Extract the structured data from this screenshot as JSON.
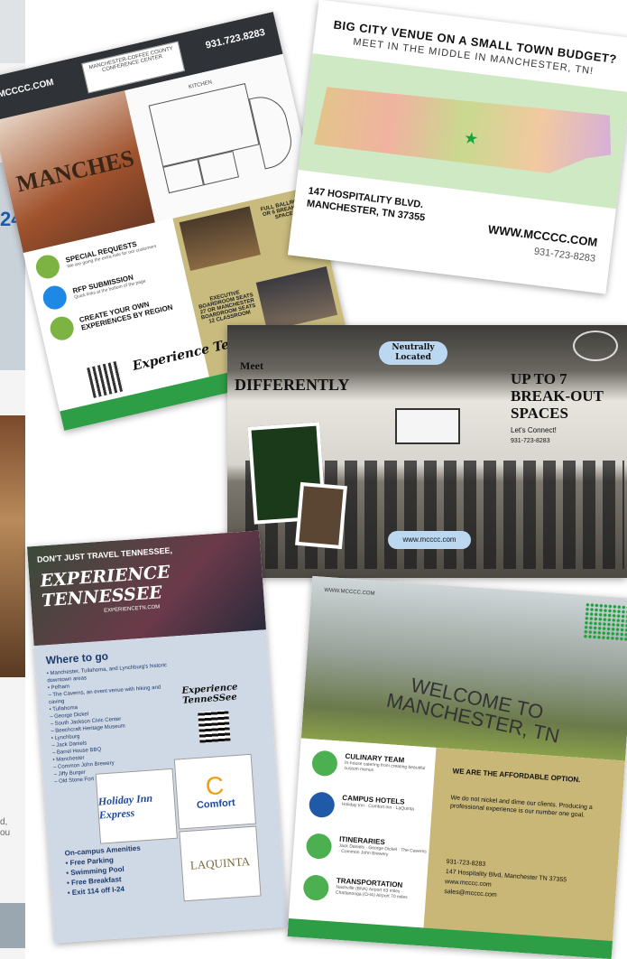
{
  "strip": {
    "number": "24",
    "caption": "d,\nou"
  },
  "card1": {
    "site": "MCCCC.COM",
    "phone": "931.723.8283",
    "logo": "MANCHESTER-COFFEE COUNTY CONFERENCE CENTER",
    "building_text": "MANCHES",
    "plan_label": "KITCHEN",
    "special_title": "SPECIAL REQUESTS",
    "special_desc": "We are going the extra mile for our customers",
    "rfp_title": "RFP SUBMISSION",
    "rfp_desc": "Quick links at the bottom of the page",
    "create_title": "CREATE YOUR OWN EXPERIENCES BY REGION",
    "ballroom": "FULL BALLROOM OR 6 BREAKOUT SPACES",
    "executive": "EXECUTIVE BOARDROOM SEATS 27 OR MANCHESTER BOARDROOM SEATS 12 CLASSROOM",
    "experience": "Experience TenneSSee"
  },
  "card2": {
    "headline": "BIG CITY VENUE ON A SMALL TOWN BUDGET?",
    "subhead": "MEET IN THE MIDDLE IN MANCHESTER, TN!",
    "address_line1": "147 HOSPITALITY BLVD.",
    "address_line2": "MANCHESTER, TN 37355",
    "website": "WWW.MCCCC.COM",
    "phone": "931-723-8283"
  },
  "card3": {
    "pill": "Neutrally Located",
    "meet": "Meet",
    "differently": "DIFFERENTLY",
    "upto": "UP TO 7 BREAK-OUT SPACES",
    "connect": "Let's Connect!",
    "phone": "931-723-8283",
    "website": "www.mcccc.com"
  },
  "card4": {
    "dont": "DON'T JUST TRAVEL TENNESSEE,",
    "experience": "EXPERIENCE TENNESSEE",
    "experience_url": "EXPERIENCETN.COM",
    "where": "Where to go",
    "list": "• Manchester, Tullahoma, and Lynchburg's historic downtown areas\n• Pelham\n  – The Caverns, an event venue with hiking and caving\n• Tullahoma\n  – George Dickel\n  – South Jackson Civic Center\n  – Beechcraft Heritage Museum\n• Lynchburg\n  – Jack Daniels\n  – Barrel House BBQ\n• Manchester\n  – Common John Brewery\n  – Jiffy Burger\n  – Old Stone Fort",
    "experience_logo": "Experience TenneSSee",
    "hotel1": "Holiday Inn Express",
    "hotel2": "Comfort",
    "hotel3": "LAQUINTA",
    "amenities": "On-campus Amenities\n• Free Parking\n• Swimming Pool\n• Free Breakfast\n• Exit 114 off I-24"
  },
  "card5": {
    "www": "WWW.MCCCC.COM",
    "welcome": "WELCOME TO MANCHESTER, TN",
    "culinary_title": "CULINARY TEAM",
    "culinary_desc": "In-house catering from creating beautiful custom menus",
    "hotels_title": "CAMPUS HOTELS",
    "hotels_desc": "Holiday Inn · Comfort Inn · LaQuinta",
    "itin_title": "ITINERARIES",
    "itin_desc": "Jack Daniels · George Dickel · The Caverns · Common John Brewery",
    "trans_title": "TRANSPORTATION",
    "trans_desc": "Nashville (BNA) Airport 63 miles · Chattanooga (CHA) Airport 70 miles",
    "affordable": "WE ARE THE AFFORDABLE OPTION.",
    "pitch": "We do not nickel and dime our clients. Producing a professional experience is our number one goal.",
    "contact": "931-723-8283\n147 Hospitality Blvd, Manchester TN 37355\nwww.mcccc.com\nsales@mcccc.com"
  }
}
